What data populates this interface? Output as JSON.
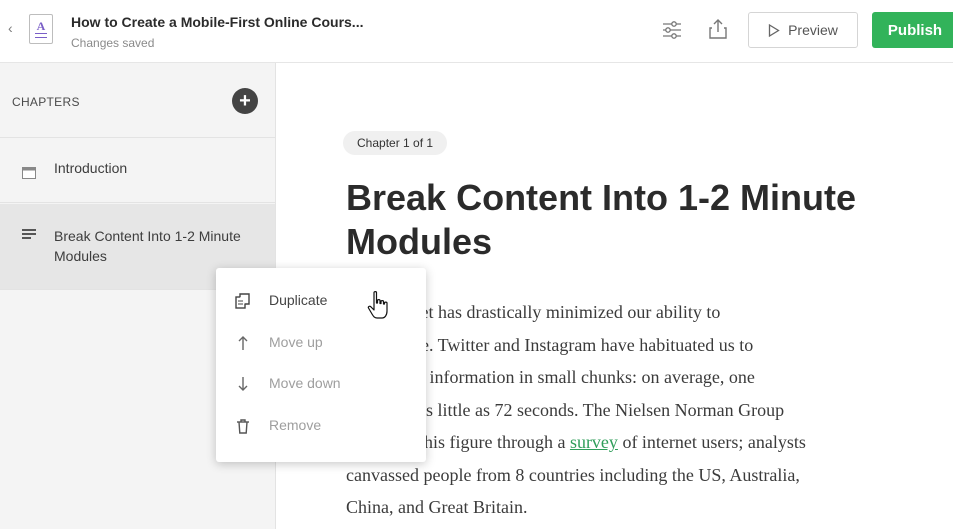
{
  "header": {
    "back_glyph": "‹",
    "doc_letter": "A",
    "title": "How to Create a Mobile-First Online Cours...",
    "status": "Changes saved",
    "preview_label": "Preview",
    "publish_label": "Publish",
    "publish_color": "#32b35a",
    "icons": [
      "settings-sliders-icon",
      "share-upload-icon",
      "play-triangle-icon"
    ]
  },
  "sidebar": {
    "heading": "CHAPTERS",
    "add_glyph": "+",
    "items": [
      {
        "label": "Introduction",
        "icon": "page-icon",
        "active": false
      },
      {
        "label": "Break Content Into 1-2 Minute Modules",
        "icon": "text-lines-icon",
        "active": true
      }
    ]
  },
  "main": {
    "badge": "Chapter 1 of 1",
    "heading": "Break Content Into 1-2 Minute Modules",
    "paragraph_lines": [
      {
        "pre": "The internet has drastically minimized our ability to",
        "link": "",
        "post": ""
      },
      {
        "pre": "concentrate. Twitter and Instagram have habituated us to",
        "link": "",
        "post": ""
      },
      {
        "pre": "consuming information in small chunks: on average, one",
        "link": "",
        "post": ""
      },
      {
        "pre": "visit lasts as little as 72 seconds. The Nielsen Norman Group",
        "link": "",
        "post": ""
      },
      {
        "pre": "arrived at this figure through a ",
        "link": "survey",
        "post": " of internet users; analysts"
      },
      {
        "pre": "canvassed people from 8 countries including the US, Australia,",
        "link": "",
        "post": ""
      },
      {
        "pre": "China, and Great Britain.",
        "link": "",
        "post": ""
      }
    ],
    "link_color": "#2f9e5a"
  },
  "context_menu": {
    "items": [
      {
        "label": "Duplicate",
        "icon": "duplicate-icon",
        "enabled": true
      },
      {
        "label": "Move up",
        "icon": "arrow-up-icon",
        "enabled": false
      },
      {
        "label": "Move down",
        "icon": "arrow-down-icon",
        "enabled": false
      },
      {
        "label": "Remove",
        "icon": "trash-icon",
        "enabled": false
      }
    ]
  }
}
